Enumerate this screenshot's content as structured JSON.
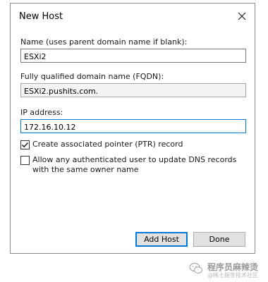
{
  "window": {
    "title": "New Host",
    "close_icon": "close-icon"
  },
  "name": {
    "label": "Name (uses parent domain name if blank):",
    "value": "ESXi2"
  },
  "fqdn": {
    "label": "Fully qualified domain name (FQDN):",
    "value": "ESXi2.pushits.com."
  },
  "ip": {
    "label": "IP address:",
    "value": "172.16.10.12"
  },
  "ptr_checkbox": {
    "label": "Create associated pointer (PTR) record",
    "checked": true
  },
  "allow_checkbox": {
    "label": "Allow any authenticated user to update DNS records with the same owner name",
    "checked": false
  },
  "buttons": {
    "add_host": "Add Host",
    "done": "Done"
  },
  "watermark": {
    "title": "程序员麻辣烫",
    "subtitle": "@稀土掘金技术社区",
    "icon": "wechat-icon"
  },
  "colors": {
    "focus_accent": "#0078d7",
    "button_face": "#e1e1e1",
    "readonly_bg": "#f4f4f4"
  }
}
